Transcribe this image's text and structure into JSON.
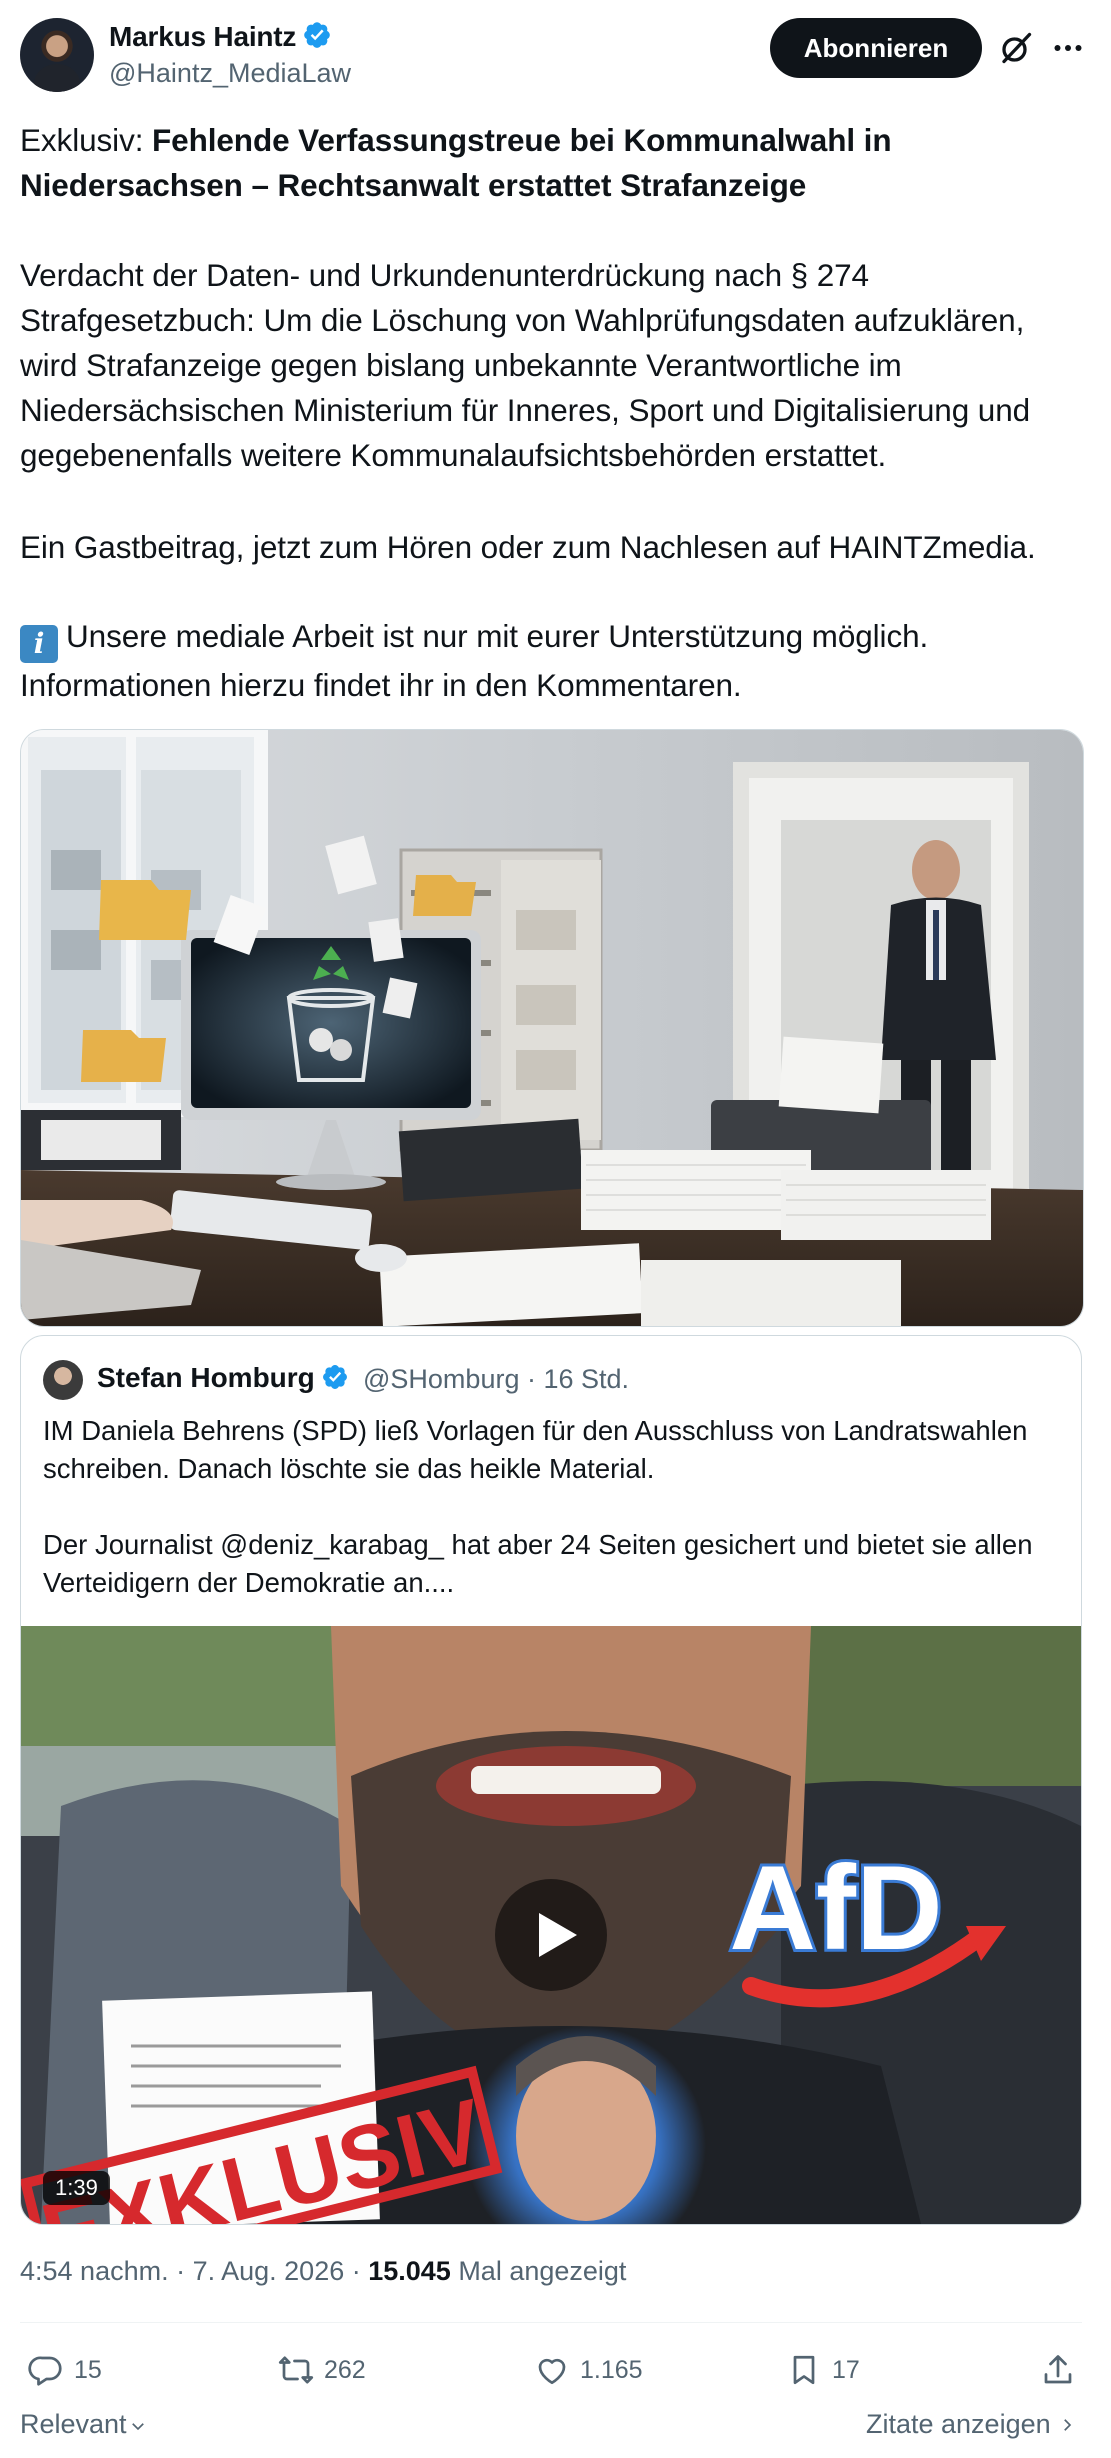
{
  "author": {
    "name": "Markus Haintz",
    "handle": "@Haintz_MediaLaw"
  },
  "header": {
    "subscribe_label": "Abonnieren"
  },
  "post": {
    "title_prefix": "Exklusiv: ",
    "title_bold": "Fehlende Verfassungstreue bei Kommunalwahl in Niedersachsen – Rechtsanwalt erstattet Strafanzeige",
    "paragraph1": "Verdacht der Daten- und Urkundenunterdrückung nach § 274 Strafgesetzbuch: Um die Löschung von Wahlprüfungsdaten aufzuklären, wird Strafanzeige gegen bislang unbekannte Verantwortliche im Niedersächsischen Ministerium für Inneres, Sport und Digitalisierung und gegebenenfalls weitere Kommunalaufsichtsbehörden erstattet.",
    "paragraph2": "Ein Gastbeitrag, jetzt zum Hören oder zum Nachlesen auf HAINTZmedia.",
    "info_icon_char": "i",
    "paragraph3": "Unsere mediale Arbeit ist nur mit eurer Unterstützung möglich. Informationen hierzu findet ihr in den Kommentaren."
  },
  "quote": {
    "name": "Stefan Homburg",
    "handle_time": "@SHomburg · 16 Std.",
    "text1": "IM Daniela Behrens (SPD) ließ Vorlagen für den Ausschluss von Landratswahlen schreiben. Danach löschte sie das heikle Material.",
    "text2": "Der Journalist @deniz_karabag_ hat aber 24 Seiten gesichert und bietet sie allen Verteidigern der Demokratie an....",
    "video_duration": "1:39",
    "video_overlay_text": "AfD",
    "video_stamp_text": "EXKLUSIV"
  },
  "meta": {
    "time_date": "4:54 nachm. · 7. Aug. 2026 · ",
    "views": "15.045",
    "views_label": " Mal angezeigt"
  },
  "actions": {
    "replies": "15",
    "reposts": "262",
    "likes": "1.165",
    "bookmarks": "17"
  },
  "footer": {
    "sort_label": "Relevant",
    "quotes_label": "Zitate anzeigen"
  },
  "colors": {
    "verified": "#1d9bf0",
    "text": "#0f1419",
    "secondary": "#536471",
    "button": "#0f1419"
  }
}
